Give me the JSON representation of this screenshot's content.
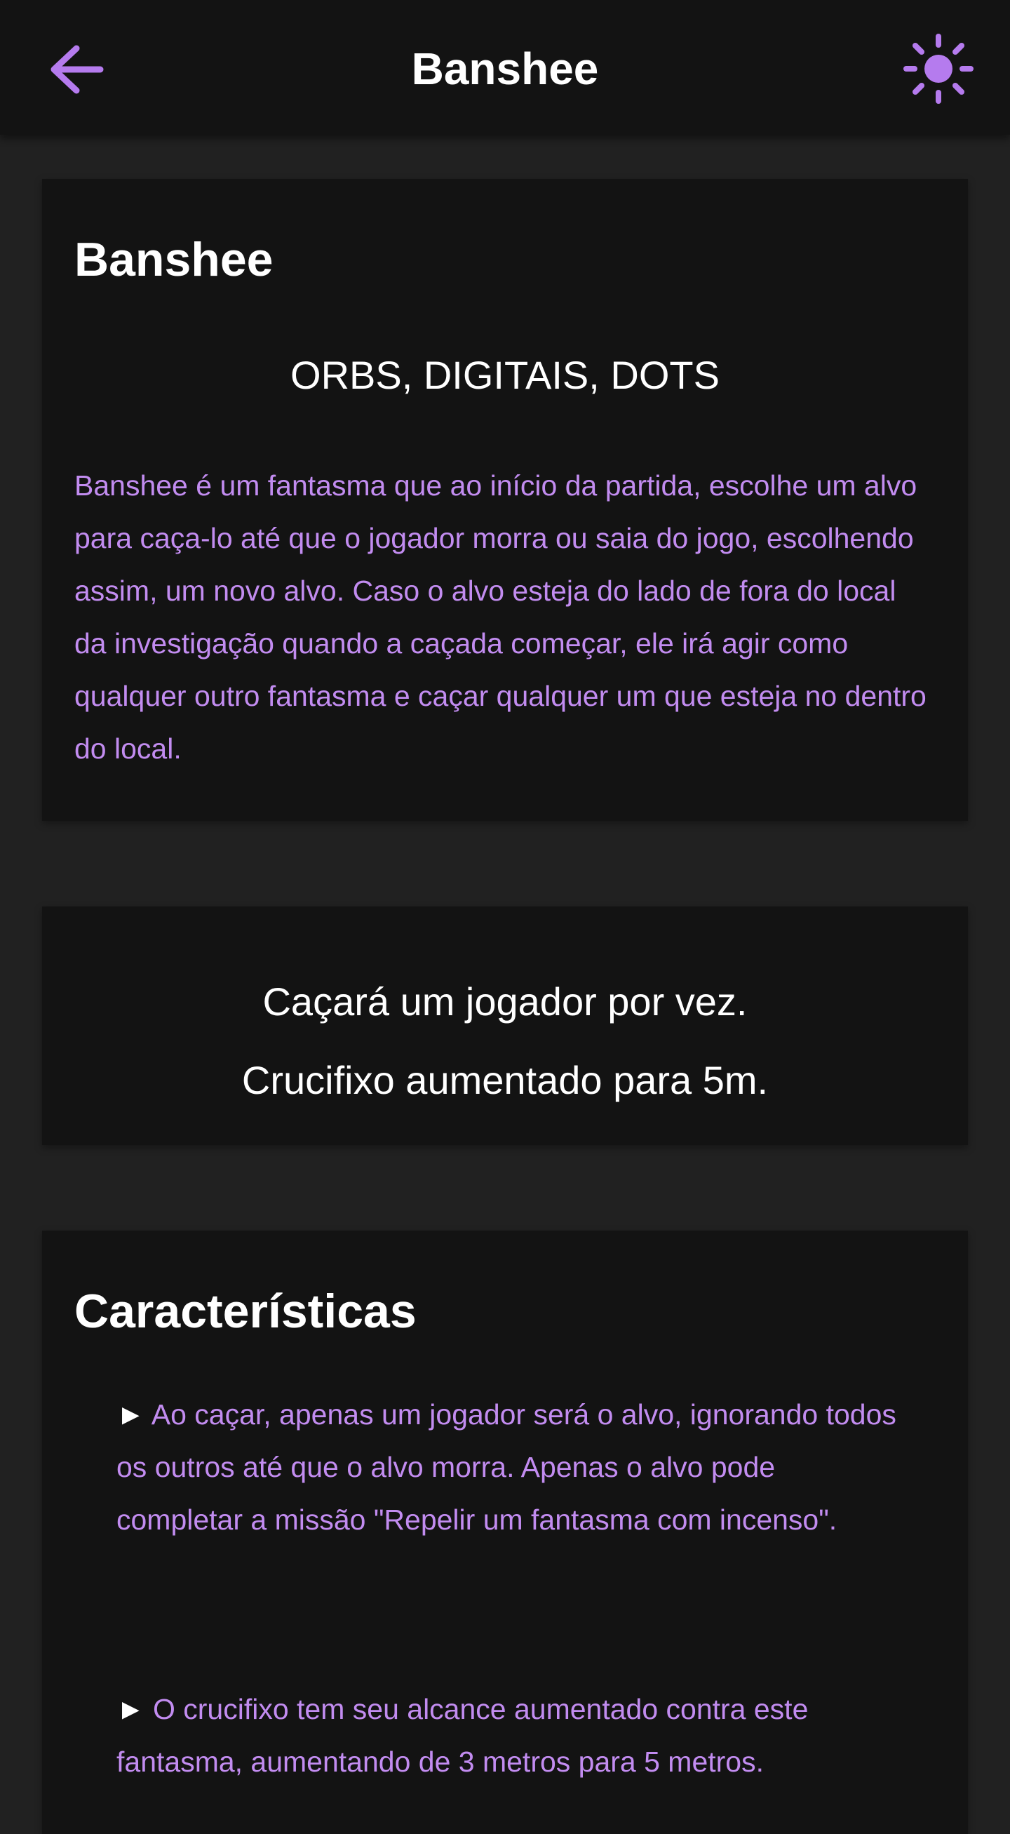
{
  "app_bar": {
    "title": "Banshee",
    "back_icon": "arrow-left-icon",
    "theme_icon": "sun-icon",
    "accent_color": "#b57bee"
  },
  "overview": {
    "title": "Banshee",
    "evidence": "ORBS, DIGITAIS, DOTS",
    "description": "Banshee é um fantasma que ao início da partida, escolhe um alvo para caça-lo até que o jogador morra ou saia do jogo, escolhendo assim, um novo alvo. Caso o alvo esteja do lado de fora do local da investigação quando a caçada começar, ele irá agir como qualquer outro fantasma e caçar qualquer um que esteja no dentro do local."
  },
  "summary": {
    "line1": "Caçará um jogador por vez.",
    "line2": "Crucifixo aumentado para 5m."
  },
  "characteristics": {
    "title": "Características",
    "bullet": "►",
    "items": [
      "Ao caçar, apenas um jogador será o alvo, ignorando todos os outros até que o alvo morra. Apenas o alvo pode completar a missão \"Repelir um fantasma com incenso\".",
      "O crucifixo tem seu alcance aumentado contra este fantasma, aumentando de 3 metros para 5 metros."
    ]
  },
  "colors": {
    "background": "#212121",
    "card": "#131313",
    "text_accent": "#c28cf0"
  }
}
